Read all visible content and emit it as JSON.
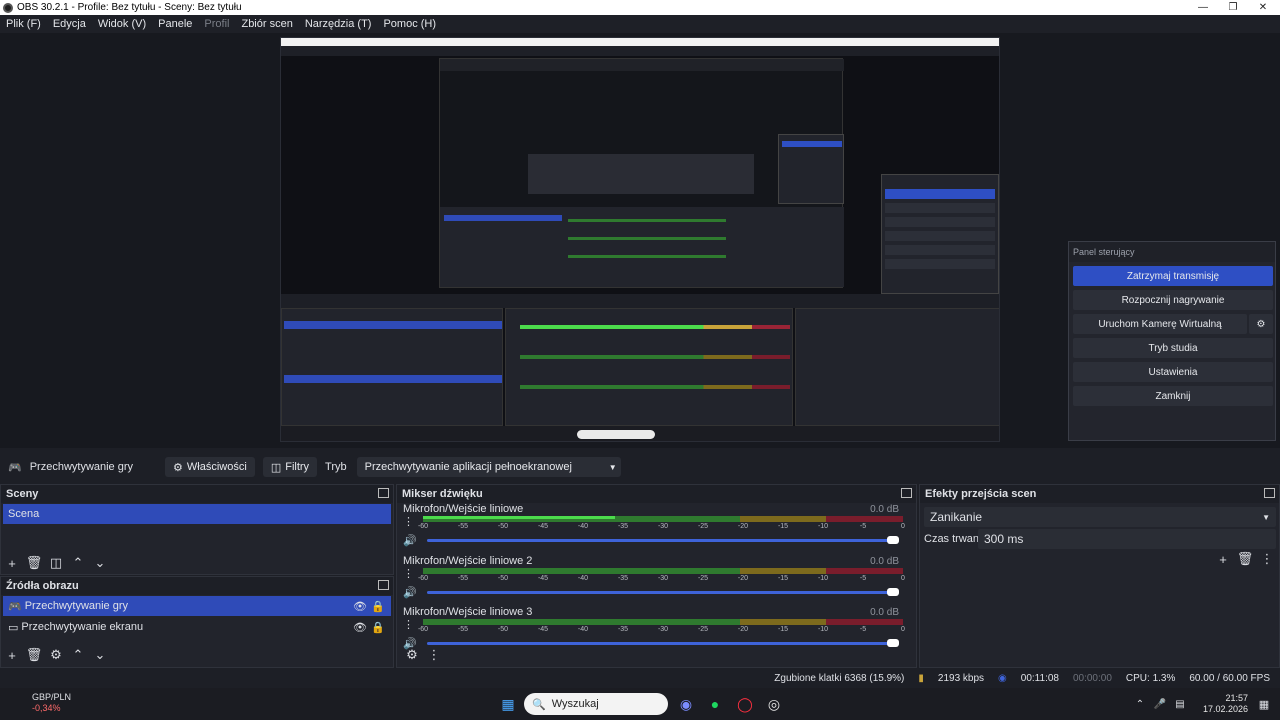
{
  "window": {
    "title": "OBS 30.2.1 - Profile: Bez tytułu - Sceny: Bez tytułu"
  },
  "menu": [
    "Plik (F)",
    "Edycja",
    "Widok (V)",
    "Panele",
    "Profil",
    "Zbiór scen",
    "Narzędzia (T)",
    "Pomoc (H)"
  ],
  "control_panel": {
    "title": "Panel sterujący",
    "buttons": [
      "Zatrzymaj transmisję",
      "Rozpocznij nagrywanie",
      "Uruchom Kamerę Wirtualną",
      "Tryb studia",
      "Ustawienia",
      "Zamknij"
    ]
  },
  "source_toolbar": {
    "source_name": "Przechwytywanie gry",
    "properties": "Właściwości",
    "filters": "Filtry",
    "mode_label": "Tryb",
    "mode_value": "Przechwytywanie aplikacji pełnoekranowej"
  },
  "scenes": {
    "title": "Sceny",
    "items": [
      "Scena"
    ]
  },
  "sources": {
    "title": "Źródła obrazu",
    "items": [
      "Przechwytywanie gry",
      "Przechwytywanie ekranu"
    ]
  },
  "mixer": {
    "title": "Mikser dźwięku",
    "channels": [
      {
        "name": "Mikrofon/Wejście liniowe",
        "db": "0.0 dB",
        "level": 0.4
      },
      {
        "name": "Mikrofon/Wejście liniowe 2",
        "db": "0.0 dB",
        "level": 0
      },
      {
        "name": "Mikrofon/Wejście liniowe 3",
        "db": "0.0 dB",
        "level": 0
      }
    ],
    "scale": [
      "-60",
      "-55",
      "-50",
      "-45",
      "-40",
      "-35",
      "-30",
      "-25",
      "-20",
      "-15",
      "-10",
      "-5",
      "0"
    ]
  },
  "transitions": {
    "title": "Efekty przejścia scen",
    "transition": "Zanikanie",
    "duration_label": "Czas trwania",
    "duration_value": "300 ms"
  },
  "status": {
    "dropped": "Zgubione klatki 6368 (15.9%)",
    "bitrate": "2193 kbps",
    "stream_time": "00:11:08",
    "rec_time": "00:00:00",
    "cpu": "CPU: 1.3%",
    "fps": "60.00 / 60.00 FPS"
  },
  "taskbar": {
    "ticker_name": "GBP/PLN",
    "ticker_change": "-0,34%",
    "search_placeholder": "Wyszukaj",
    "time": "21:57",
    "date": "17.02.2026"
  },
  "colors": {
    "accent": "#2e4fc4",
    "selection": "#2f4bb8"
  }
}
